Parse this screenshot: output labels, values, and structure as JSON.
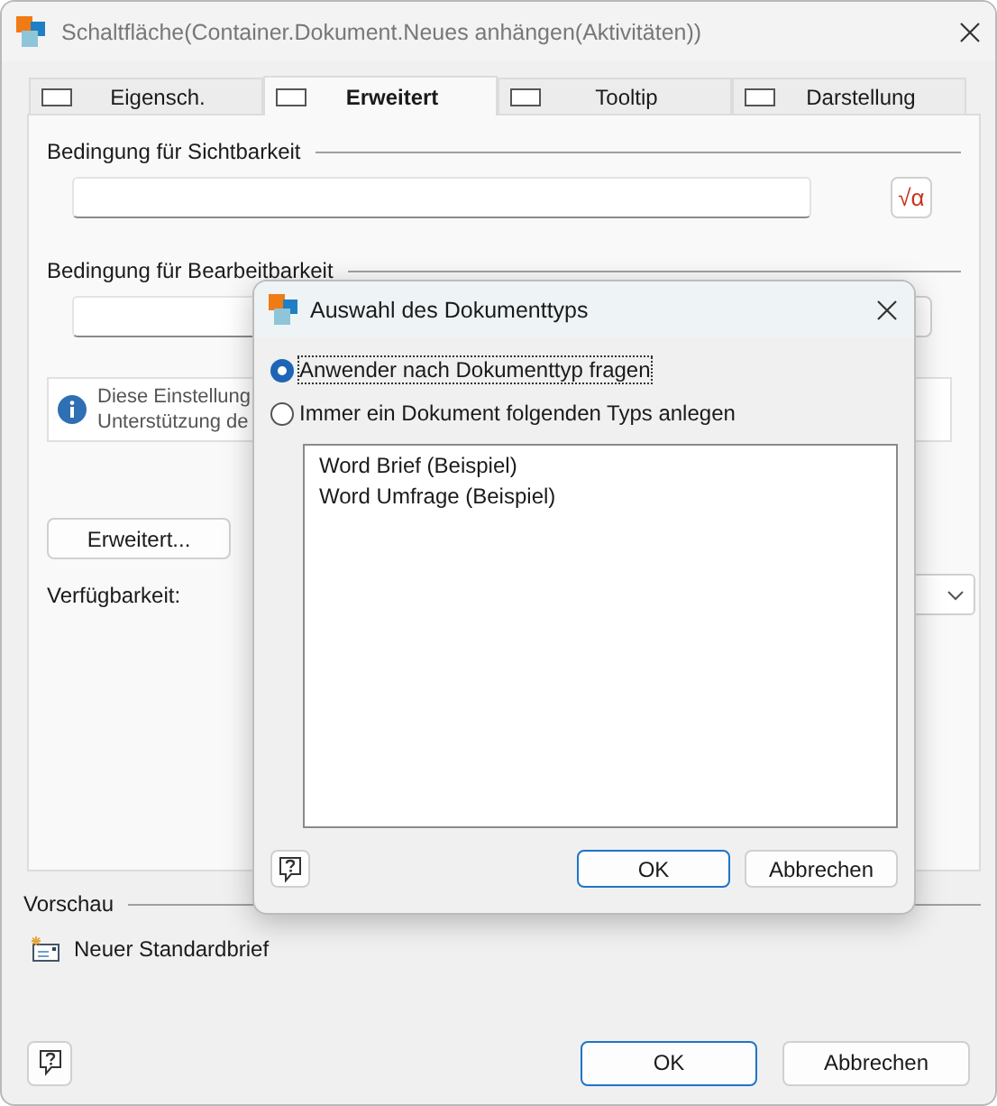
{
  "window": {
    "title": "Schaltfläche(Container.Dokument.Neues anhängen(Aktivitäten))"
  },
  "tabs": [
    {
      "label": "Eigensch.",
      "selected": false
    },
    {
      "label": "Erweitert",
      "selected": true
    },
    {
      "label": "Tooltip",
      "selected": false
    },
    {
      "label": "Darstellung",
      "selected": false
    }
  ],
  "visibility": {
    "heading": "Bedingung für Sichtbarkeit",
    "formula_button": "√α"
  },
  "editability": {
    "heading": "Bedingung für Bearbeitbarkeit"
  },
  "info": {
    "lines": [
      "Diese Einstellung",
      "Unterstützung de"
    ]
  },
  "advanced_button": "Erweitert...",
  "availability": {
    "label": "Verfügbarkeit:"
  },
  "preview": {
    "heading": "Vorschau",
    "item": "Neuer Standardbrief"
  },
  "buttons": [
    "OK",
    "Abbrechen"
  ],
  "dialog": {
    "title": "Auswahl des Dokumenttyps",
    "options": [
      {
        "label": "Anwender nach Dokumenttyp fragen",
        "selected": true
      },
      {
        "label": "Immer ein Dokument folgenden Typs anlegen",
        "selected": false
      }
    ],
    "list": [
      "Word Brief (Beispiel)",
      "Word Umfrage (Beispiel)"
    ],
    "buttons": [
      "OK",
      "Abbrechen"
    ]
  }
}
